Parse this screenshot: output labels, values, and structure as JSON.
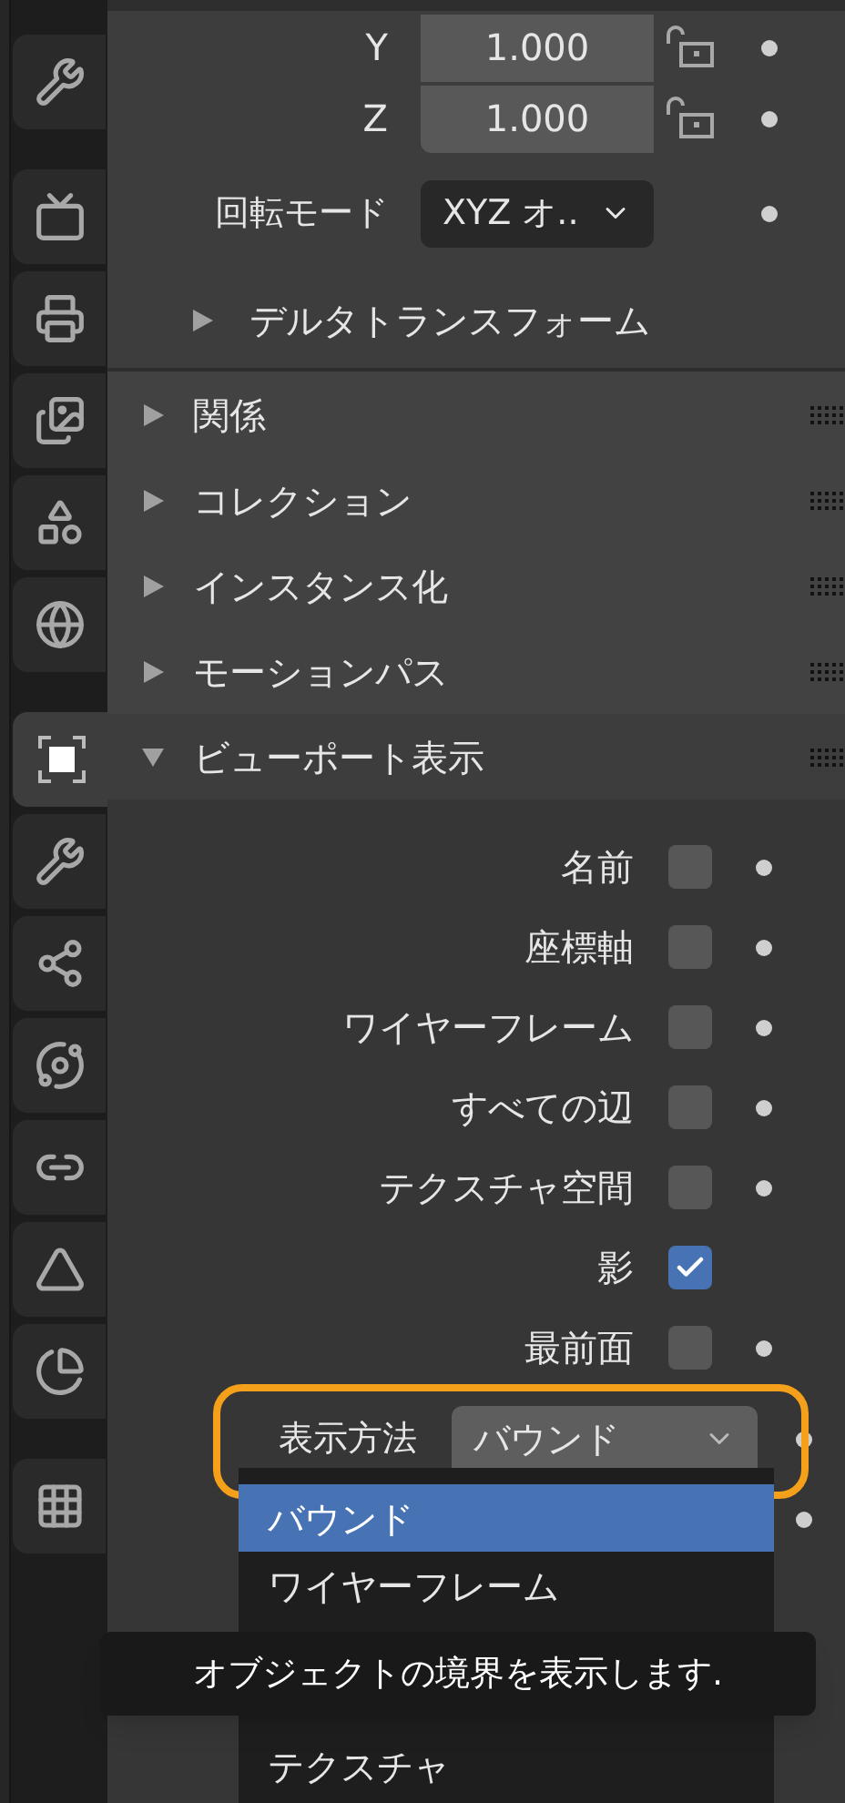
{
  "property_tabs": [
    {
      "kind": "tool",
      "selected": false
    },
    {
      "kind": "render",
      "selected": false
    },
    {
      "kind": "output",
      "selected": false
    },
    {
      "kind": "view_layer",
      "selected": false
    },
    {
      "kind": "scene",
      "selected": false
    },
    {
      "kind": "world",
      "selected": false
    },
    {
      "kind": "object",
      "selected": true
    },
    {
      "kind": "modifiers",
      "selected": false
    },
    {
      "kind": "particles",
      "selected": false
    },
    {
      "kind": "physics",
      "selected": false
    },
    {
      "kind": "constraints",
      "selected": false
    },
    {
      "kind": "data",
      "selected": false
    },
    {
      "kind": "material",
      "selected": false
    },
    {
      "kind": "texture",
      "selected": false
    }
  ],
  "transform": {
    "scale_rows": [
      {
        "label": "Y",
        "value": "1.000",
        "locked": false
      },
      {
        "label": "Z",
        "value": "1.000",
        "locked": false
      }
    ],
    "rotation_mode": {
      "label": "回転モード",
      "value": "XYZ オ.."
    },
    "delta_transform": {
      "label": "デルタトランスフォーム",
      "expanded": false
    }
  },
  "panels": [
    {
      "label": "関係",
      "expanded": false
    },
    {
      "label": "コレクション",
      "expanded": false
    },
    {
      "label": "インスタンス化",
      "expanded": false
    },
    {
      "label": "モーションパス",
      "expanded": false
    },
    {
      "label": "ビューポート表示",
      "expanded": true
    }
  ],
  "viewport_display": {
    "checkboxes": [
      {
        "label": "名前",
        "checked": false,
        "keyframe_dot": true
      },
      {
        "label": "座標軸",
        "checked": false,
        "keyframe_dot": true
      },
      {
        "label": "ワイヤーフレーム",
        "checked": false,
        "keyframe_dot": true
      },
      {
        "label": "すべての辺",
        "checked": false,
        "keyframe_dot": true
      },
      {
        "label": "テクスチャ空間",
        "checked": false,
        "keyframe_dot": true
      },
      {
        "label": "影",
        "checked": true,
        "keyframe_dot": false
      },
      {
        "label": "最前面",
        "checked": false,
        "keyframe_dot": true
      }
    ],
    "display_as": {
      "label": "表示方法",
      "value": "バウンド",
      "highlighted": true
    }
  },
  "dropdown_menu": {
    "items": [
      {
        "label": "バウンド",
        "selected": true
      },
      {
        "label": "ワイヤーフレーム",
        "selected": false
      },
      {
        "label": "テクスチャ",
        "selected": false
      }
    ]
  },
  "tooltip": {
    "text": "オブジェクトの境界を表示します."
  }
}
